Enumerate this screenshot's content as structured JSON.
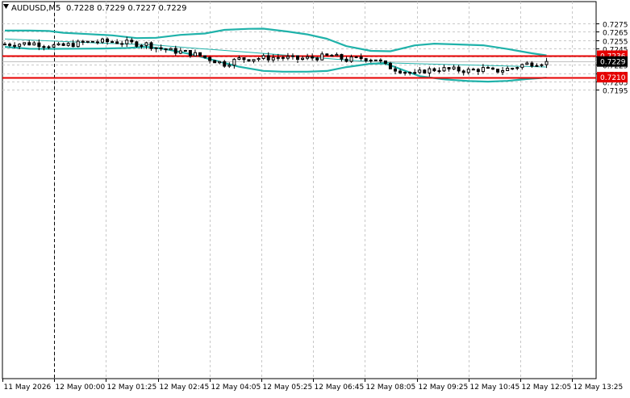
{
  "header": {
    "symbol": "AUDUSD,M5",
    "ohlc": "0.7228 0.7229 0.7227 0.7229"
  },
  "colors": {
    "background": "#ffffff",
    "grid": "#c8c8c8",
    "candle": "#000000",
    "band": "#20b2aa",
    "level": "#e60000",
    "price_label_bg": "#000000"
  },
  "chart_data": {
    "type": "candlestick",
    "title": "AUDUSD,M5",
    "ylim": [
      0.719,
      0.7283
    ],
    "y_ticks": [
      "0.7275",
      "0.7265",
      "0.7255",
      "0.7245",
      "0.7235",
      "0.7225",
      "0.7215",
      "0.7205",
      "0.7195"
    ],
    "x_ticks": [
      "11 May 2026",
      "12 May 00:00",
      "12 May 01:25",
      "12 May 02:45",
      "12 May 04:05",
      "12 May 05:25",
      "12 May 06:45",
      "12 May 08:05",
      "12 May 09:25",
      "12 May 10:45",
      "12 May 12:05",
      "12 May 13:25"
    ],
    "grid": true,
    "bar_count": 112,
    "close_anchors": [
      [
        0,
        0.725
      ],
      [
        6,
        0.7251
      ],
      [
        11,
        0.7247
      ],
      [
        14,
        0.725
      ],
      [
        18,
        0.7253
      ],
      [
        22,
        0.7253
      ],
      [
        26,
        0.7251
      ],
      [
        29,
        0.725
      ],
      [
        31,
        0.7246
      ],
      [
        34,
        0.7242
      ],
      [
        37,
        0.724
      ],
      [
        40,
        0.7236
      ],
      [
        43,
        0.723
      ],
      [
        45,
        0.7226
      ],
      [
        48,
        0.7232
      ],
      [
        52,
        0.7233
      ],
      [
        56,
        0.7234
      ],
      [
        60,
        0.7232
      ],
      [
        64,
        0.7234
      ],
      [
        67,
        0.7236
      ],
      [
        70,
        0.7231
      ],
      [
        73,
        0.7233
      ],
      [
        76,
        0.7232
      ],
      [
        78,
        0.7224
      ],
      [
        80,
        0.722
      ],
      [
        82,
        0.7217
      ],
      [
        84,
        0.7213
      ],
      [
        86,
        0.7218
      ],
      [
        89,
        0.722
      ],
      [
        92,
        0.7219
      ],
      [
        95,
        0.7218
      ],
      [
        98,
        0.722
      ],
      [
        100,
        0.7217
      ],
      [
        102,
        0.7219
      ],
      [
        104,
        0.7221
      ],
      [
        106,
        0.7225
      ],
      [
        108,
        0.7227
      ],
      [
        110,
        0.7228
      ],
      [
        111,
        0.7229
      ]
    ],
    "series": [
      {
        "name": "",
        "type": "line",
        "values": [
          [
            0,
            0.72663
          ],
          [
            5,
            0.72663
          ],
          [
            9,
            0.72658
          ],
          [
            12,
            0.72637
          ],
          [
            17,
            0.72621
          ],
          [
            22,
            0.72606
          ],
          [
            27,
            0.72572
          ],
          [
            31,
            0.72576
          ],
          [
            36,
            0.72611
          ],
          [
            41,
            0.72628
          ],
          [
            45,
            0.72672
          ],
          [
            50,
            0.72685
          ],
          [
            53,
            0.72687
          ],
          [
            58,
            0.72651
          ],
          [
            62,
            0.72617
          ],
          [
            66,
            0.72565
          ],
          [
            70,
            0.72475
          ],
          [
            75,
            0.72418
          ],
          [
            79,
            0.72413
          ],
          [
            84,
            0.72485
          ],
          [
            88,
            0.72505
          ],
          [
            92,
            0.72497
          ],
          [
            98,
            0.72486
          ],
          [
            103,
            0.72441
          ],
          [
            108,
            0.72389
          ],
          [
            111,
            0.72364
          ]
        ]
      },
      {
        "name": "",
        "type": "line",
        "values": [
          [
            0,
            0.72563
          ],
          [
            10,
            0.72536
          ],
          [
            20,
            0.72511
          ],
          [
            30,
            0.72492
          ],
          [
            40,
            0.72446
          ],
          [
            50,
            0.72402
          ],
          [
            60,
            0.72355
          ],
          [
            70,
            0.72307
          ],
          [
            80,
            0.72271
          ],
          [
            90,
            0.72254
          ],
          [
            100,
            0.7224
          ],
          [
            111,
            0.72223
          ]
        ]
      },
      {
        "name": "",
        "type": "line",
        "values": [
          [
            0,
            0.72466
          ],
          [
            5,
            0.72444
          ],
          [
            10,
            0.72443
          ],
          [
            15,
            0.72445
          ],
          [
            20,
            0.72447
          ],
          [
            25,
            0.72452
          ],
          [
            29,
            0.72466
          ],
          [
            33,
            0.72439
          ],
          [
            38,
            0.7238
          ],
          [
            43,
            0.72303
          ],
          [
            48,
            0.72226
          ],
          [
            53,
            0.72176
          ],
          [
            57,
            0.72167
          ],
          [
            62,
            0.72167
          ],
          [
            66,
            0.72175
          ],
          [
            70,
            0.72222
          ],
          [
            75,
            0.72263
          ],
          [
            78,
            0.72265
          ],
          [
            81,
            0.722
          ],
          [
            85,
            0.72113
          ],
          [
            90,
            0.72074
          ],
          [
            95,
            0.72053
          ],
          [
            99,
            0.72047
          ],
          [
            103,
            0.72055
          ],
          [
            107,
            0.72078
          ],
          [
            111,
            0.72094
          ]
        ]
      }
    ],
    "horizontal_lines": [
      0.7236,
      0.721
    ],
    "vertical_line_bar": 10,
    "current_price": 0.7229,
    "level_labels": [
      "0.7236",
      "0.7210"
    ],
    "current_price_label": "0.7229"
  }
}
